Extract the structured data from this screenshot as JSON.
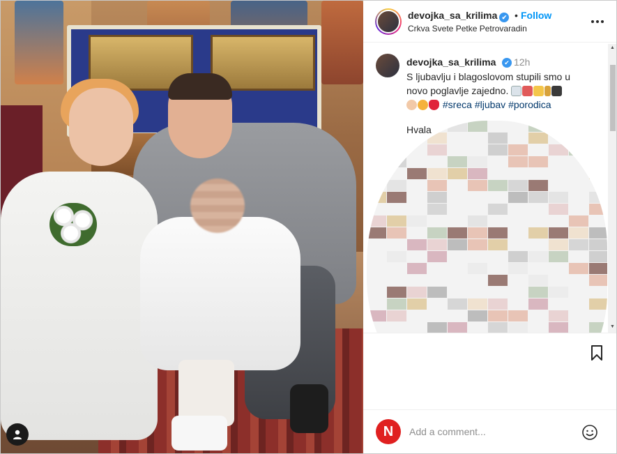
{
  "post": {
    "username": "devojka_sa_krilima",
    "verified_mark": "✔",
    "separator": "•",
    "follow_label": "Follow",
    "location": "Crkva Svete Petke Petrovaradin"
  },
  "caption": {
    "username": "devojka_sa_krilima",
    "time": "12h",
    "line1": "S ljubavlju i blagoslovom stupili smo u",
    "line2": "novo poglavlje zajedno.",
    "hashtags": [
      "#sreca",
      "#ljubav",
      "#porodica"
    ],
    "thanks_fragment": "Hvala"
  },
  "comment": {
    "avatar_letter": "N",
    "placeholder": "Add a comment..."
  },
  "icons": {
    "more": "more-horizontal-icon",
    "bookmark": "bookmark-icon",
    "emoji": "emoji-smile-icon",
    "user": "user-icon"
  },
  "colors": {
    "accent": "#0095f6",
    "hashtag": "#00376b",
    "verified": "#3897f0",
    "brand_n": "#e02020"
  }
}
